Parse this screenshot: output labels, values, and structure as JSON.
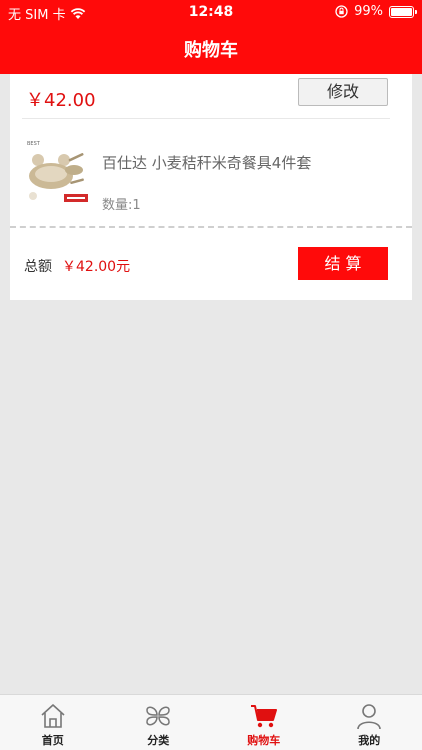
{
  "status_bar": {
    "carrier": "无 SIM 卡",
    "time": "12:48",
    "battery": "99%",
    "battery_level": 0.99
  },
  "header": {
    "title": "购物车"
  },
  "cart": {
    "top_price": "￥42.00",
    "edit_label": "修改",
    "item": {
      "name": "百仕达 小麦秸秆米奇餐具4件套",
      "quantity_text": "数量:1",
      "image_icon": "tableware-product-image"
    },
    "total_label": "总额",
    "total_value": "￥42.00元",
    "checkout_label": "结 算"
  },
  "tabbar": {
    "items": [
      {
        "label": "首页",
        "icon": "home-icon",
        "active": false
      },
      {
        "label": "分类",
        "icon": "category-icon",
        "active": false
      },
      {
        "label": "购物车",
        "icon": "cart-icon",
        "active": true
      },
      {
        "label": "我的",
        "icon": "profile-icon",
        "active": false
      }
    ]
  },
  "colors": {
    "brand": "#ff0a0a",
    "price": "#e01010",
    "background": "#e8e8e8"
  }
}
